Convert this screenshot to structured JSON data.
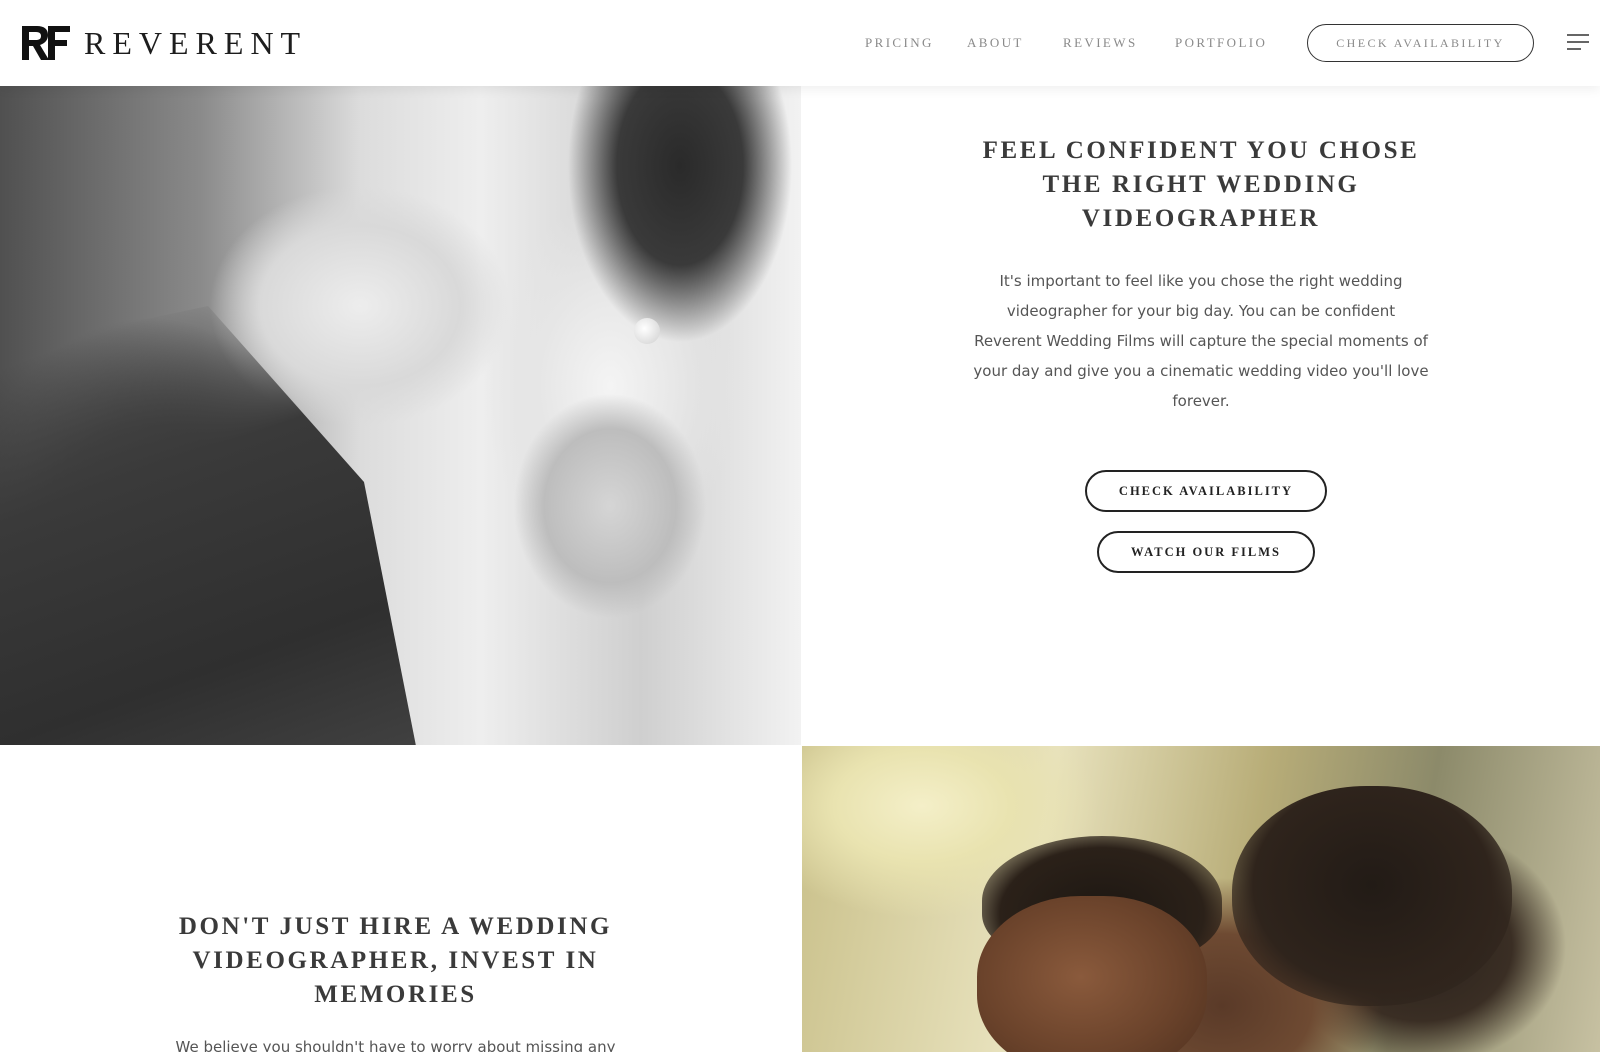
{
  "brand": {
    "name": "REVERENT",
    "mark_text": "RF"
  },
  "nav": {
    "items": [
      {
        "label": "PRICING"
      },
      {
        "label": "ABOUT"
      },
      {
        "label": "REVIEWS"
      },
      {
        "label": "PORTFOLIO"
      }
    ],
    "cta_label": "CHECK AVAILABILITY"
  },
  "section_confident": {
    "heading_lines": [
      "FEEL CONFIDENT YOU CHOSE",
      "THE RIGHT WEDDING",
      "VIDEOGRAPHER"
    ],
    "body_lines": [
      "It's important to feel like you chose the right wedding",
      "videographer for your big day. You can be confident",
      "Reverent Wedding Films will capture the special moments of",
      "your day and give you a cinematic wedding video you'll love",
      "forever."
    ],
    "primary_button": "CHECK AVAILABILITY",
    "secondary_button": "WATCH OUR FILMS"
  },
  "section_invest": {
    "heading_lines": [
      "DON'T JUST HIRE A WEDDING",
      "VIDEOGRAPHER, INVEST IN",
      "MEMORIES"
    ],
    "body_partial": "We believe you shouldn't have to worry about missing any"
  },
  "icons": {
    "menu": "hamburger-menu-icon",
    "logo": "rf-monogram-logo"
  },
  "colors": {
    "text_dark": "#222222",
    "heading": "#3a3a3a",
    "nav_text": "#8a8a8a",
    "background": "#ffffff"
  }
}
